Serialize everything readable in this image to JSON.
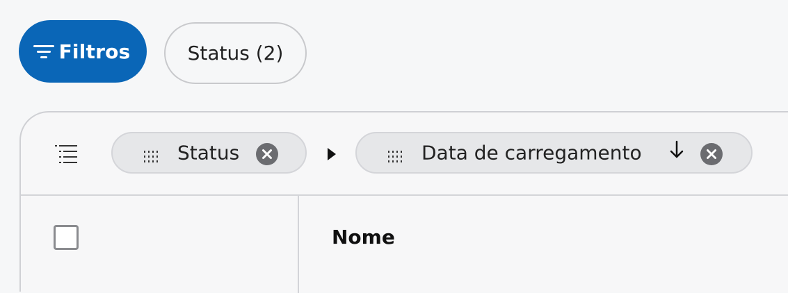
{
  "toolbar": {
    "filter_button_label": "Filtros",
    "status_chip_label": "Status (2)"
  },
  "grouping": {
    "chips": [
      {
        "label": "Status",
        "removable": true
      },
      {
        "label": "Data de carregamento",
        "sort": "descending",
        "removable": true
      }
    ]
  },
  "table": {
    "columns": [
      {
        "label": "Nome"
      }
    ]
  },
  "icons": {
    "filter": "filter-icon",
    "group": "group-list-icon",
    "drag": "drag-handle-icon",
    "close": "close-circle-icon",
    "expand": "play-arrow-icon",
    "sort": "arrow-down-icon"
  },
  "colors": {
    "primary": "#0a66b7",
    "chip_bg": "#e6e7e9",
    "close_icon": "#6b6c70"
  }
}
